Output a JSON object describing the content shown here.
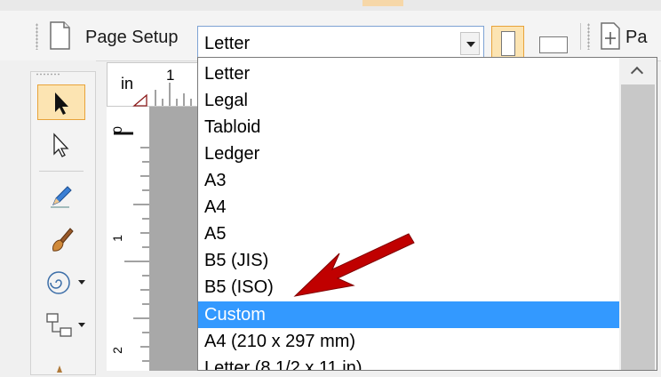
{
  "toolbar": {
    "page_setup_label": "Page Setup",
    "page_size_value": "Letter",
    "truncated_label": "Pa"
  },
  "ruler": {
    "unit": "in",
    "h_tick": "1",
    "v_ticks": [
      "0",
      "1",
      "2"
    ]
  },
  "dropdown": {
    "options": [
      "Letter",
      "Legal",
      "Tabloid",
      "Ledger",
      "A3",
      "A4",
      "A5",
      "B5 (JIS)",
      "B5 (ISO)",
      "Custom",
      "A4 (210 x 297 mm)",
      "Letter (8 1/2 x 11 in)"
    ],
    "highlighted": "Custom"
  },
  "colors": {
    "highlight": "#3399ff",
    "selected_tool_bg": "#fce4b2",
    "selected_tool_border": "#e8a33a",
    "annotation_arrow": "#c00000"
  },
  "icons": {
    "page_setup": "page-setup-icon",
    "portrait": "portrait-icon",
    "landscape": "landscape-icon",
    "select_tool": "arrow-pointer-icon",
    "direct_select_tool": "hollow-pointer-icon",
    "pencil_tool": "pencil-icon",
    "brush_tool": "brush-icon",
    "spiral_tool": "spiral-icon",
    "connector_tool": "connector-icon"
  }
}
